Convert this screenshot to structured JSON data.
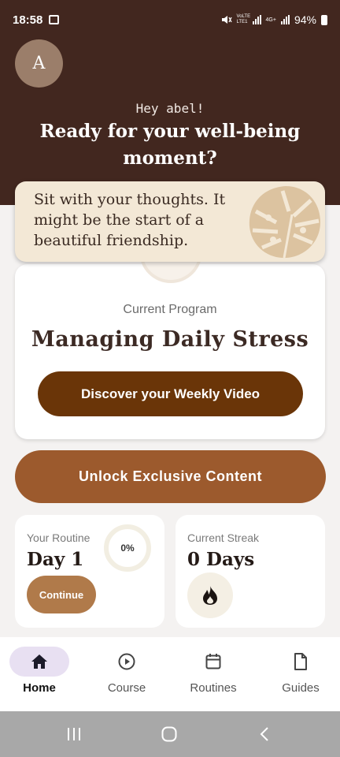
{
  "status_bar": {
    "time": "18:58",
    "network_label": "VoLTE LTE1",
    "network_label_2": "4G+",
    "battery": "94%"
  },
  "header": {
    "avatar_initial": "A",
    "greeting": "Hey abel!",
    "headline": "Ready for your well-being moment?"
  },
  "quote_card": {
    "text": "Sit with your thoughts. It might be the start of a beautiful friendship."
  },
  "program": {
    "label": "Current Program",
    "title": "Managing Daily Stress",
    "button_label": "Discover your Weekly Video"
  },
  "unlock_button": "Unlock Exclusive Content",
  "routine": {
    "label": "Your Routine",
    "value": "Day 1",
    "progress": "0%",
    "button_label": "Continue"
  },
  "streak": {
    "label": "Current Streak",
    "value": "0 Days"
  },
  "bottom_nav": {
    "items": [
      {
        "label": "Home",
        "icon": "home-icon",
        "active": true
      },
      {
        "label": "Course",
        "icon": "play-circle-icon"
      },
      {
        "label": "Routines",
        "icon": "calendar-icon"
      },
      {
        "label": "Guides",
        "icon": "document-icon"
      }
    ]
  },
  "colors": {
    "header_bg": "#42271f",
    "quote_bg": "#f3e8d6",
    "video_button": "#6a3508",
    "unlock_button": "#9c5a2d",
    "continue_button": "#b07a4a",
    "nav_active_pill": "#e8e0f2"
  }
}
